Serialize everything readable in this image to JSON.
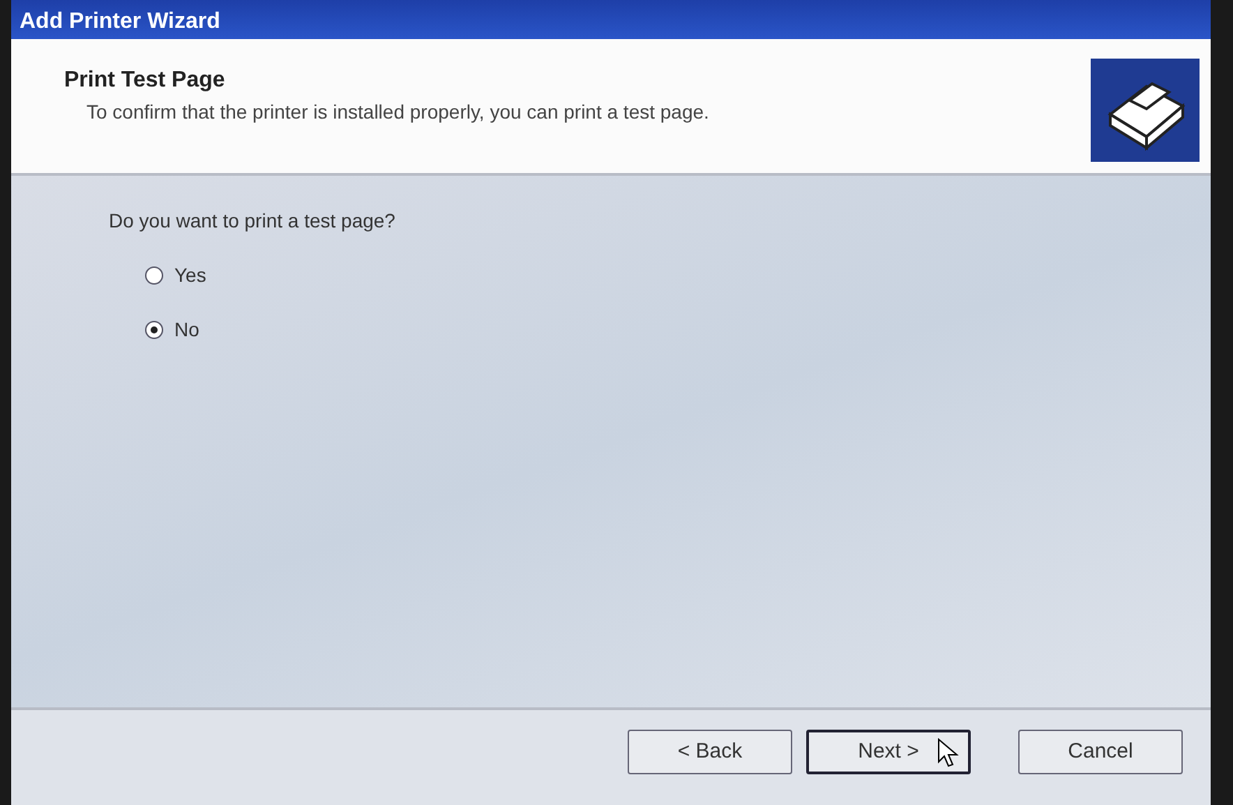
{
  "window": {
    "title": "Add Printer Wizard"
  },
  "header": {
    "title": "Print Test Page",
    "subtitle": "To confirm that the printer is installed properly, you can print a test page."
  },
  "question": "Do you want to print a test page?",
  "options": [
    {
      "label": "Yes",
      "selected": false
    },
    {
      "label": "No",
      "selected": true
    }
  ],
  "buttons": [
    {
      "label": "< Back",
      "kind": "back",
      "focused": false
    },
    {
      "label": "Next >",
      "kind": "next",
      "focused": true
    },
    {
      "label": "Cancel",
      "kind": "cancel",
      "focused": false
    }
  ]
}
